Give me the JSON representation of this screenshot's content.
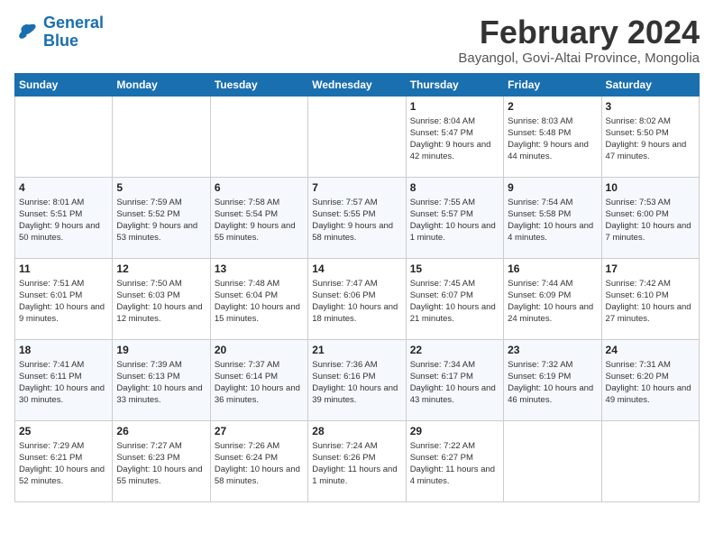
{
  "logo": {
    "line1": "General",
    "line2": "Blue"
  },
  "title": "February 2024",
  "subtitle": "Bayangol, Govi-Altai Province, Mongolia",
  "weekdays": [
    "Sunday",
    "Monday",
    "Tuesday",
    "Wednesday",
    "Thursday",
    "Friday",
    "Saturday"
  ],
  "weeks": [
    [
      {
        "day": "",
        "info": ""
      },
      {
        "day": "",
        "info": ""
      },
      {
        "day": "",
        "info": ""
      },
      {
        "day": "",
        "info": ""
      },
      {
        "day": "1",
        "info": "Sunrise: 8:04 AM\nSunset: 5:47 PM\nDaylight: 9 hours\nand 42 minutes."
      },
      {
        "day": "2",
        "info": "Sunrise: 8:03 AM\nSunset: 5:48 PM\nDaylight: 9 hours\nand 44 minutes."
      },
      {
        "day": "3",
        "info": "Sunrise: 8:02 AM\nSunset: 5:50 PM\nDaylight: 9 hours\nand 47 minutes."
      }
    ],
    [
      {
        "day": "4",
        "info": "Sunrise: 8:01 AM\nSunset: 5:51 PM\nDaylight: 9 hours\nand 50 minutes."
      },
      {
        "day": "5",
        "info": "Sunrise: 7:59 AM\nSunset: 5:52 PM\nDaylight: 9 hours\nand 53 minutes."
      },
      {
        "day": "6",
        "info": "Sunrise: 7:58 AM\nSunset: 5:54 PM\nDaylight: 9 hours\nand 55 minutes."
      },
      {
        "day": "7",
        "info": "Sunrise: 7:57 AM\nSunset: 5:55 PM\nDaylight: 9 hours\nand 58 minutes."
      },
      {
        "day": "8",
        "info": "Sunrise: 7:55 AM\nSunset: 5:57 PM\nDaylight: 10 hours\nand 1 minute."
      },
      {
        "day": "9",
        "info": "Sunrise: 7:54 AM\nSunset: 5:58 PM\nDaylight: 10 hours\nand 4 minutes."
      },
      {
        "day": "10",
        "info": "Sunrise: 7:53 AM\nSunset: 6:00 PM\nDaylight: 10 hours\nand 7 minutes."
      }
    ],
    [
      {
        "day": "11",
        "info": "Sunrise: 7:51 AM\nSunset: 6:01 PM\nDaylight: 10 hours\nand 9 minutes."
      },
      {
        "day": "12",
        "info": "Sunrise: 7:50 AM\nSunset: 6:03 PM\nDaylight: 10 hours\nand 12 minutes."
      },
      {
        "day": "13",
        "info": "Sunrise: 7:48 AM\nSunset: 6:04 PM\nDaylight: 10 hours\nand 15 minutes."
      },
      {
        "day": "14",
        "info": "Sunrise: 7:47 AM\nSunset: 6:06 PM\nDaylight: 10 hours\nand 18 minutes."
      },
      {
        "day": "15",
        "info": "Sunrise: 7:45 AM\nSunset: 6:07 PM\nDaylight: 10 hours\nand 21 minutes."
      },
      {
        "day": "16",
        "info": "Sunrise: 7:44 AM\nSunset: 6:09 PM\nDaylight: 10 hours\nand 24 minutes."
      },
      {
        "day": "17",
        "info": "Sunrise: 7:42 AM\nSunset: 6:10 PM\nDaylight: 10 hours\nand 27 minutes."
      }
    ],
    [
      {
        "day": "18",
        "info": "Sunrise: 7:41 AM\nSunset: 6:11 PM\nDaylight: 10 hours\nand 30 minutes."
      },
      {
        "day": "19",
        "info": "Sunrise: 7:39 AM\nSunset: 6:13 PM\nDaylight: 10 hours\nand 33 minutes."
      },
      {
        "day": "20",
        "info": "Sunrise: 7:37 AM\nSunset: 6:14 PM\nDaylight: 10 hours\nand 36 minutes."
      },
      {
        "day": "21",
        "info": "Sunrise: 7:36 AM\nSunset: 6:16 PM\nDaylight: 10 hours\nand 39 minutes."
      },
      {
        "day": "22",
        "info": "Sunrise: 7:34 AM\nSunset: 6:17 PM\nDaylight: 10 hours\nand 43 minutes."
      },
      {
        "day": "23",
        "info": "Sunrise: 7:32 AM\nSunset: 6:19 PM\nDaylight: 10 hours\nand 46 minutes."
      },
      {
        "day": "24",
        "info": "Sunrise: 7:31 AM\nSunset: 6:20 PM\nDaylight: 10 hours\nand 49 minutes."
      }
    ],
    [
      {
        "day": "25",
        "info": "Sunrise: 7:29 AM\nSunset: 6:21 PM\nDaylight: 10 hours\nand 52 minutes."
      },
      {
        "day": "26",
        "info": "Sunrise: 7:27 AM\nSunset: 6:23 PM\nDaylight: 10 hours\nand 55 minutes."
      },
      {
        "day": "27",
        "info": "Sunrise: 7:26 AM\nSunset: 6:24 PM\nDaylight: 10 hours\nand 58 minutes."
      },
      {
        "day": "28",
        "info": "Sunrise: 7:24 AM\nSunset: 6:26 PM\nDaylight: 11 hours\nand 1 minute."
      },
      {
        "day": "29",
        "info": "Sunrise: 7:22 AM\nSunset: 6:27 PM\nDaylight: 11 hours\nand 4 minutes."
      },
      {
        "day": "",
        "info": ""
      },
      {
        "day": "",
        "info": ""
      }
    ]
  ]
}
